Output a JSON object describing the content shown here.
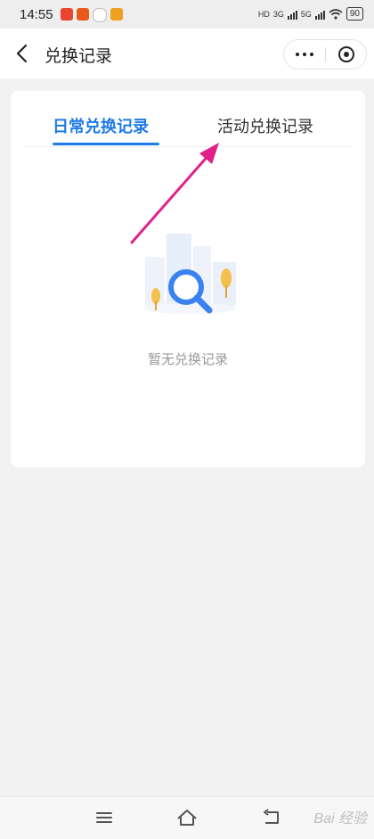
{
  "status_bar": {
    "time": "14:55",
    "network1": "HD",
    "network2": "3G",
    "network3": "5G",
    "battery": "90"
  },
  "nav": {
    "title": "兑换记录"
  },
  "tabs": {
    "daily": "日常兑换记录",
    "activity": "活动兑换记录"
  },
  "empty_state": {
    "text": "暂无兑换记录"
  },
  "watermark": "Bai 经验",
  "colors": {
    "accent": "#1e7be8",
    "annotation": "#e0218a"
  }
}
